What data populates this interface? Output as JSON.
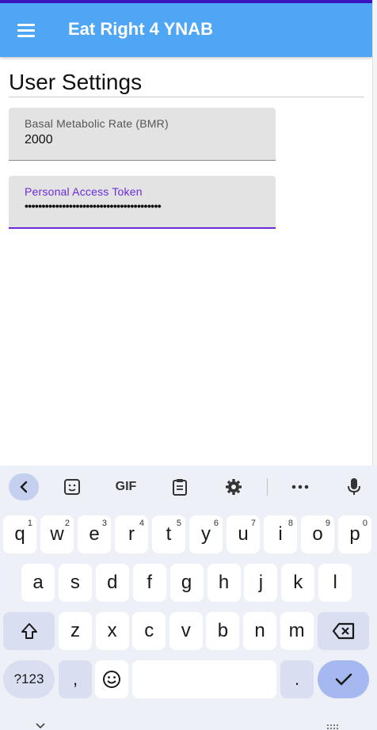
{
  "app": {
    "title": "Eat Right 4 YNAB"
  },
  "page": {
    "title": "User Settings"
  },
  "fields": {
    "bmr": {
      "label": "Basal Metabolic Rate (BMR)",
      "value": "2000"
    },
    "token": {
      "label": "Personal Access Token",
      "value": "••••••••••••••••••••••••••••••••••••••••"
    }
  },
  "keyboard": {
    "toolbar": [
      "back-icon",
      "sticker-icon",
      "GIF",
      "clipboard-icon",
      "gear-icon",
      "more-icon",
      "mic-icon"
    ],
    "gif_label": "GIF",
    "row1": [
      {
        "k": "q",
        "n": "1"
      },
      {
        "k": "w",
        "n": "2"
      },
      {
        "k": "e",
        "n": "3"
      },
      {
        "k": "r",
        "n": "4"
      },
      {
        "k": "t",
        "n": "5"
      },
      {
        "k": "y",
        "n": "6"
      },
      {
        "k": "u",
        "n": "7"
      },
      {
        "k": "i",
        "n": "8"
      },
      {
        "k": "o",
        "n": "9"
      },
      {
        "k": "p",
        "n": "0"
      }
    ],
    "row2": [
      "a",
      "s",
      "d",
      "f",
      "g",
      "h",
      "j",
      "k",
      "l"
    ],
    "row3": [
      "z",
      "x",
      "c",
      "v",
      "b",
      "n",
      "m"
    ],
    "symbols_label": "?123",
    "comma": ",",
    "period": ".",
    "colors": {
      "accent": "#6a2bd8",
      "app_bar": "#4fa6f5",
      "enter": "#a6b8f0"
    }
  }
}
